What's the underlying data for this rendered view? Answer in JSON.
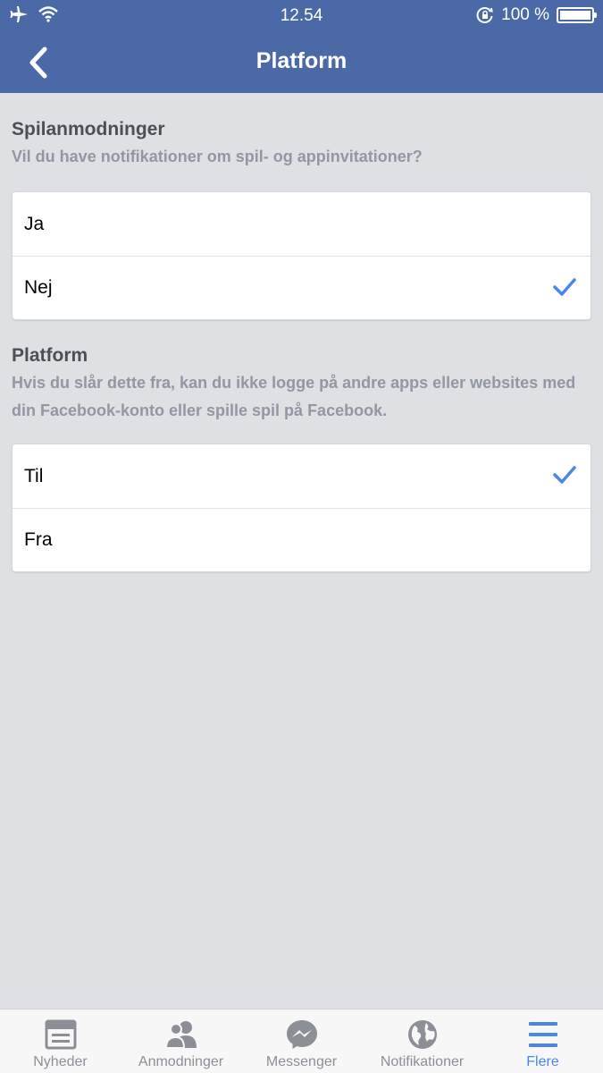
{
  "status_bar": {
    "time": "12.54",
    "battery_text": "100 %"
  },
  "nav": {
    "title": "Platform"
  },
  "sections": [
    {
      "title": "Spilanmodninger",
      "description": "Vil du have notifikationer om spil- og appinvitationer?",
      "options": [
        {
          "label": "Ja",
          "selected": false
        },
        {
          "label": "Nej",
          "selected": true
        }
      ]
    },
    {
      "title": "Platform",
      "description": "Hvis du slår dette fra, kan du ikke logge på andre apps eller websites med din Facebook-konto eller spille spil på Facebook.",
      "options": [
        {
          "label": "Til",
          "selected": true
        },
        {
          "label": "Fra",
          "selected": false
        }
      ]
    }
  ],
  "tabs": [
    {
      "label": "Nyheder",
      "icon": "news-feed-icon",
      "active": false
    },
    {
      "label": "Anmodninger",
      "icon": "friend-requests-icon",
      "active": false
    },
    {
      "label": "Messenger",
      "icon": "messenger-icon",
      "active": false
    },
    {
      "label": "Notifikationer",
      "icon": "globe-icon",
      "active": false
    },
    {
      "label": "Flere",
      "icon": "menu-icon",
      "active": true
    }
  ],
  "colors": {
    "header": "#4b69a6",
    "accent": "#4a86e8",
    "background": "#dfe0e4"
  }
}
